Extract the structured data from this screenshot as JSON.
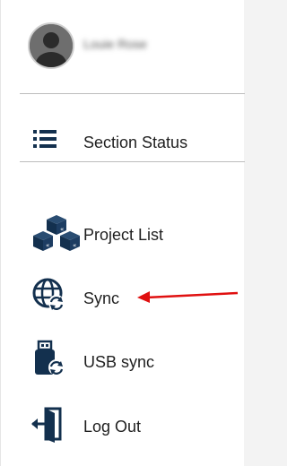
{
  "profile": {
    "name": "Louie Rose"
  },
  "menu": {
    "section_status": "Section Status",
    "project_list": "Project List",
    "sync": "Sync",
    "usb_sync": "USB sync",
    "log_out": "Log Out"
  },
  "colors": {
    "icon": "#13304e",
    "arrow": "#e01010",
    "divider": "#bcbcbc"
  }
}
